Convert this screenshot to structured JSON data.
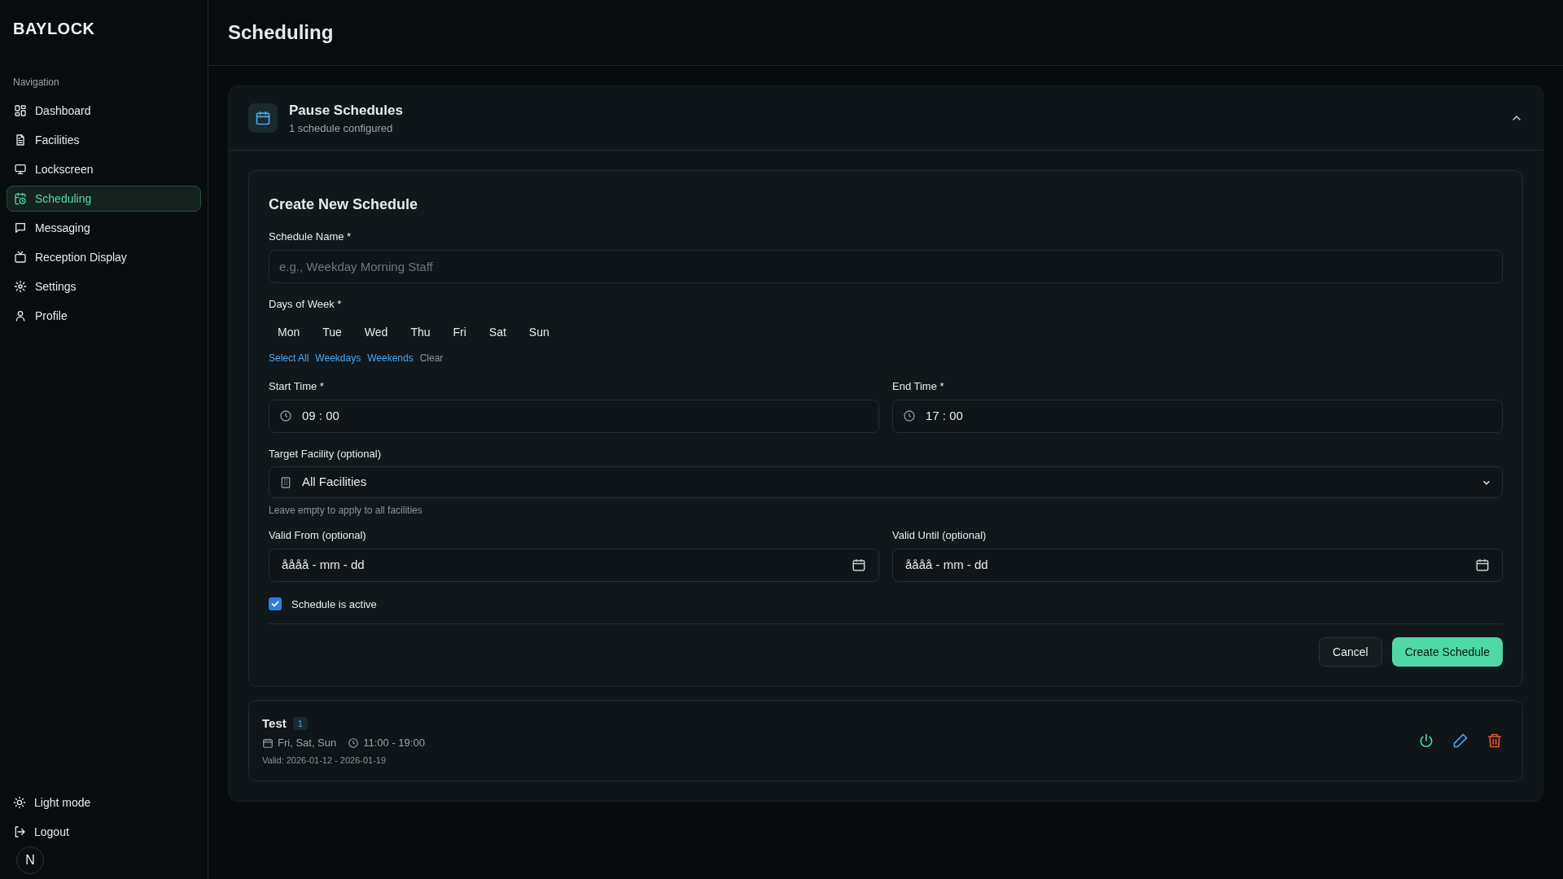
{
  "app": {
    "logo": "BAYLOCK"
  },
  "sidebar": {
    "section_label": "Navigation",
    "items": [
      {
        "label": "Dashboard",
        "selected": false
      },
      {
        "label": "Facilities",
        "selected": false
      },
      {
        "label": "Lockscreen",
        "selected": false
      },
      {
        "label": "Scheduling",
        "selected": true
      },
      {
        "label": "Messaging",
        "selected": false
      },
      {
        "label": "Reception Display",
        "selected": false
      },
      {
        "label": "Settings",
        "selected": false
      },
      {
        "label": "Profile",
        "selected": false
      }
    ],
    "footer": [
      {
        "label": "Light mode"
      },
      {
        "label": "Logout"
      }
    ],
    "dev_badge": "N"
  },
  "page": {
    "title": "Scheduling"
  },
  "panel": {
    "title": "Pause Schedules",
    "subtitle": "1 schedule configured",
    "expanded": true,
    "form": {
      "title": "Create New Schedule",
      "name_label": "Schedule Name *",
      "name_placeholder": "e.g., Weekday Morning Staff",
      "days_label": "Days of Week *",
      "days": [
        {
          "label": "Mon",
          "selected": false
        },
        {
          "label": "Tue",
          "selected": false
        },
        {
          "label": "Wed",
          "selected": false
        },
        {
          "label": "Thu",
          "selected": false
        },
        {
          "label": "Fri",
          "selected": false
        },
        {
          "label": "Sat",
          "selected": false
        },
        {
          "label": "Sun",
          "selected": false
        }
      ],
      "quick_links": [
        {
          "label": "Select All",
          "kind": "link"
        },
        {
          "label": "Weekdays",
          "kind": "link"
        },
        {
          "label": "Weekends",
          "kind": "link"
        },
        {
          "label": "Clear",
          "kind": "muted"
        }
      ],
      "start_label": "Start Time *",
      "start_value": "09 : 00",
      "end_label": "End Time *",
      "end_value": "17 : 00",
      "facility_label": "Target Facility (optional)",
      "facility_value": "All Facilities",
      "facility_hint": "Leave empty to apply to all facilities",
      "valid_from_label": "Valid From (optional)",
      "valid_from_value": "åååå - mm - dd",
      "valid_until_label": "Valid Until (optional)",
      "valid_until_value": "åååå - mm - dd",
      "active_label": "Schedule is active",
      "active_checked": true,
      "cancel": "Cancel",
      "submit": "Create Schedule"
    },
    "schedules": [
      {
        "name": "Test",
        "badge": "1",
        "days": "Fri, Sat, Sun",
        "time": "11:00 - 19:00",
        "valid": "Valid: 2026-01-12 - 2026-01-19",
        "active": true
      }
    ]
  }
}
